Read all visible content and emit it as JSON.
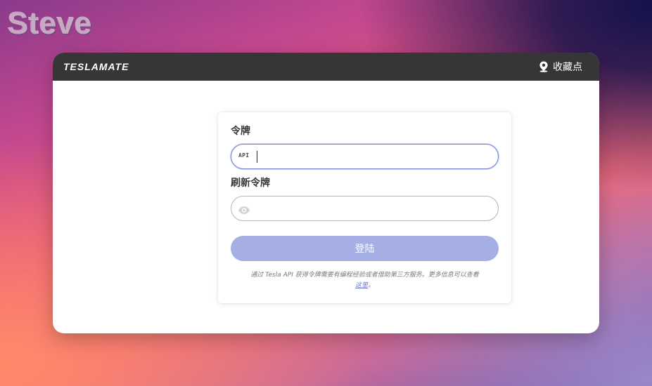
{
  "watermark": {
    "text": "Steve"
  },
  "navbar": {
    "logo": "TESLAMATE",
    "geofences_label": "收藏点",
    "geofences_icon": "map-pin-icon"
  },
  "form": {
    "token_label": "令牌",
    "token_value": "",
    "token_icon_text": "API",
    "refresh_token_label": "刷新令牌",
    "refresh_token_value": "",
    "refresh_token_icon": "eye-icon",
    "login_button_label": "登陆",
    "help_text": "通过 Tesla API 获得令牌需要有编程经验或者借助第三方服务。更多信息可以查看",
    "help_link_text": "这里",
    "help_suffix": "。"
  },
  "colors": {
    "navbar_bg": "#363636",
    "button_disabled": "#a6afe3",
    "focus_border": "#7180d8",
    "link": "#6b7bd6"
  }
}
